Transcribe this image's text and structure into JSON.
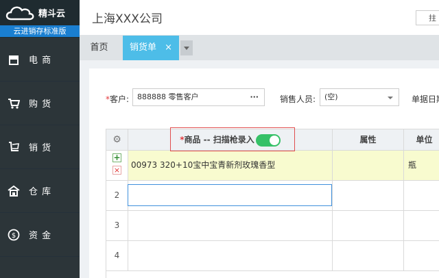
{
  "brand": {
    "name": "精斗云",
    "edition": "云进销存标准版"
  },
  "sidebar": {
    "items": [
      {
        "label": "电 商",
        "icon": "store-icon"
      },
      {
        "label": "购 货",
        "icon": "cart-icon"
      },
      {
        "label": "销 货",
        "icon": "sales-icon"
      },
      {
        "label": "仓 库",
        "icon": "warehouse-icon"
      },
      {
        "label": "资 金",
        "icon": "money-icon"
      }
    ]
  },
  "header": {
    "company": "上海XXX公司",
    "right_fragment": "拄"
  },
  "tabs": {
    "home": "首页",
    "active": "销货单",
    "close": "×"
  },
  "form": {
    "customer_label": "客户:",
    "customer_value": "888888 零售客户",
    "customer_more": "···",
    "sales_label": "销售人员:",
    "sales_value": "(空)",
    "date_label": "单据日期"
  },
  "grid": {
    "headers": {
      "product": "商品 -- 扫描枪录入",
      "attr": "属性",
      "unit": "单位"
    },
    "rows": [
      {
        "num": "",
        "product": "00973 320+10宝中宝青新剂玫瑰香型",
        "attr": "",
        "unit": "瓶"
      },
      {
        "num": "2",
        "product": "",
        "attr": "",
        "unit": ""
      },
      {
        "num": "3",
        "product": "",
        "attr": "",
        "unit": ""
      },
      {
        "num": "4",
        "product": "",
        "attr": "",
        "unit": ""
      }
    ],
    "scan_toggle_on": true
  },
  "colors": {
    "accent": "#4dbde8",
    "toggle": "#36c167",
    "highlight": "#e04c4c",
    "sidebar": "#2c3539"
  }
}
